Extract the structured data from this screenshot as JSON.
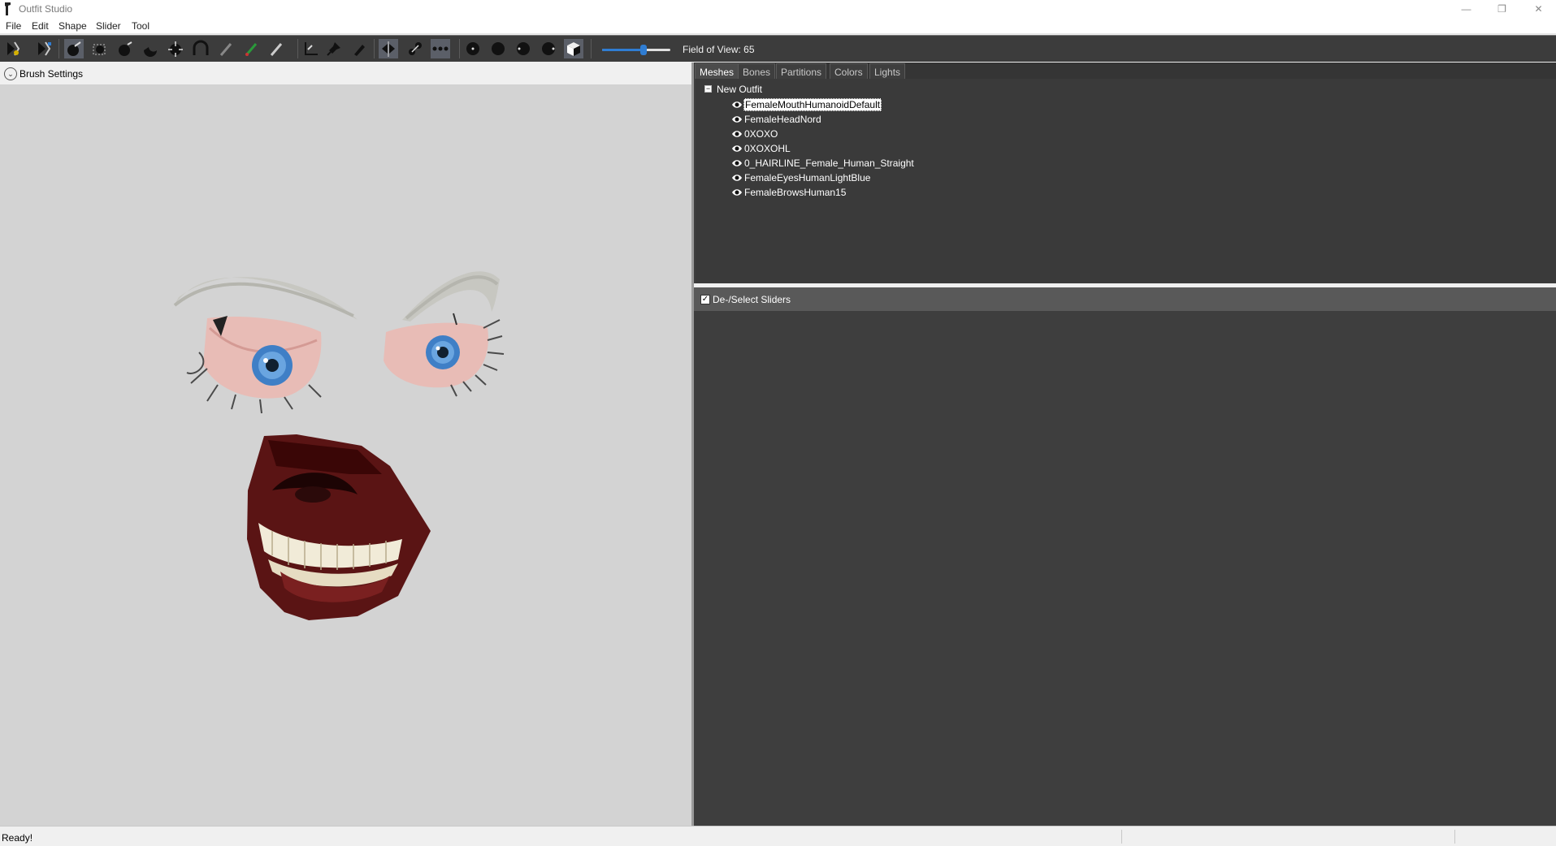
{
  "window": {
    "title": "Outfit Studio",
    "controls": {
      "minimize": "—",
      "maximize": "❐",
      "close": "✕"
    }
  },
  "menu": [
    "File",
    "Edit",
    "Shape",
    "Slider",
    "Tool"
  ],
  "toolbar": {
    "buttons": [
      "select-tool-icon",
      "transform-tool-icon",
      "brush-inflate-icon",
      "brush-mask-icon",
      "brush-deflate-icon",
      "brush-move-icon",
      "brush-smooth-icon",
      "brush-undiff-icon",
      "brush-weight-icon",
      "brush-color-icon",
      "brush-alpha-icon",
      "pivot-tool-icon",
      "pin-tool-icon",
      "vertex-edit-icon",
      "mirror-x-icon",
      "connected-only-icon",
      "vertex-dots-icon",
      "brush-size-small-icon",
      "brush-size-medium-icon",
      "brush-size-strength-icon",
      "brush-size-large-icon",
      "view-cube-icon"
    ],
    "field_of_view": {
      "label": "Field of View: 65",
      "value": 65,
      "min": 10,
      "max": 100
    }
  },
  "brush_settings": {
    "label": "Brush Settings",
    "toggle_glyph": "⌄"
  },
  "tabs": [
    "Meshes",
    "Bones",
    "Partitions",
    "Colors",
    "Lights"
  ],
  "meshes": {
    "root_toggle": "−",
    "root": "New Outfit",
    "items": [
      {
        "name": "FemaleMouthHumanoidDefault",
        "selected": true
      },
      {
        "name": "FemaleHeadNord",
        "selected": false
      },
      {
        "name": "0XOXO",
        "selected": false
      },
      {
        "name": "0XOXOHL",
        "selected": false
      },
      {
        "name": "0_HAIRLINE_Female_Human_Straight",
        "selected": false
      },
      {
        "name": "FemaleEyesHumanLightBlue",
        "selected": false
      },
      {
        "name": "FemaleBrowsHuman15",
        "selected": false
      }
    ]
  },
  "sliders": {
    "select_all_label": "De-/Select Sliders",
    "checked": true,
    "check_glyph": "✓"
  },
  "status": {
    "text": "Ready!"
  },
  "colors": {
    "toolbar_bg": "#3c3c3c",
    "panel_bg": "#3e3e3e",
    "viewport_bg": "#d3d3d3",
    "accent": "#2f7dd3"
  }
}
